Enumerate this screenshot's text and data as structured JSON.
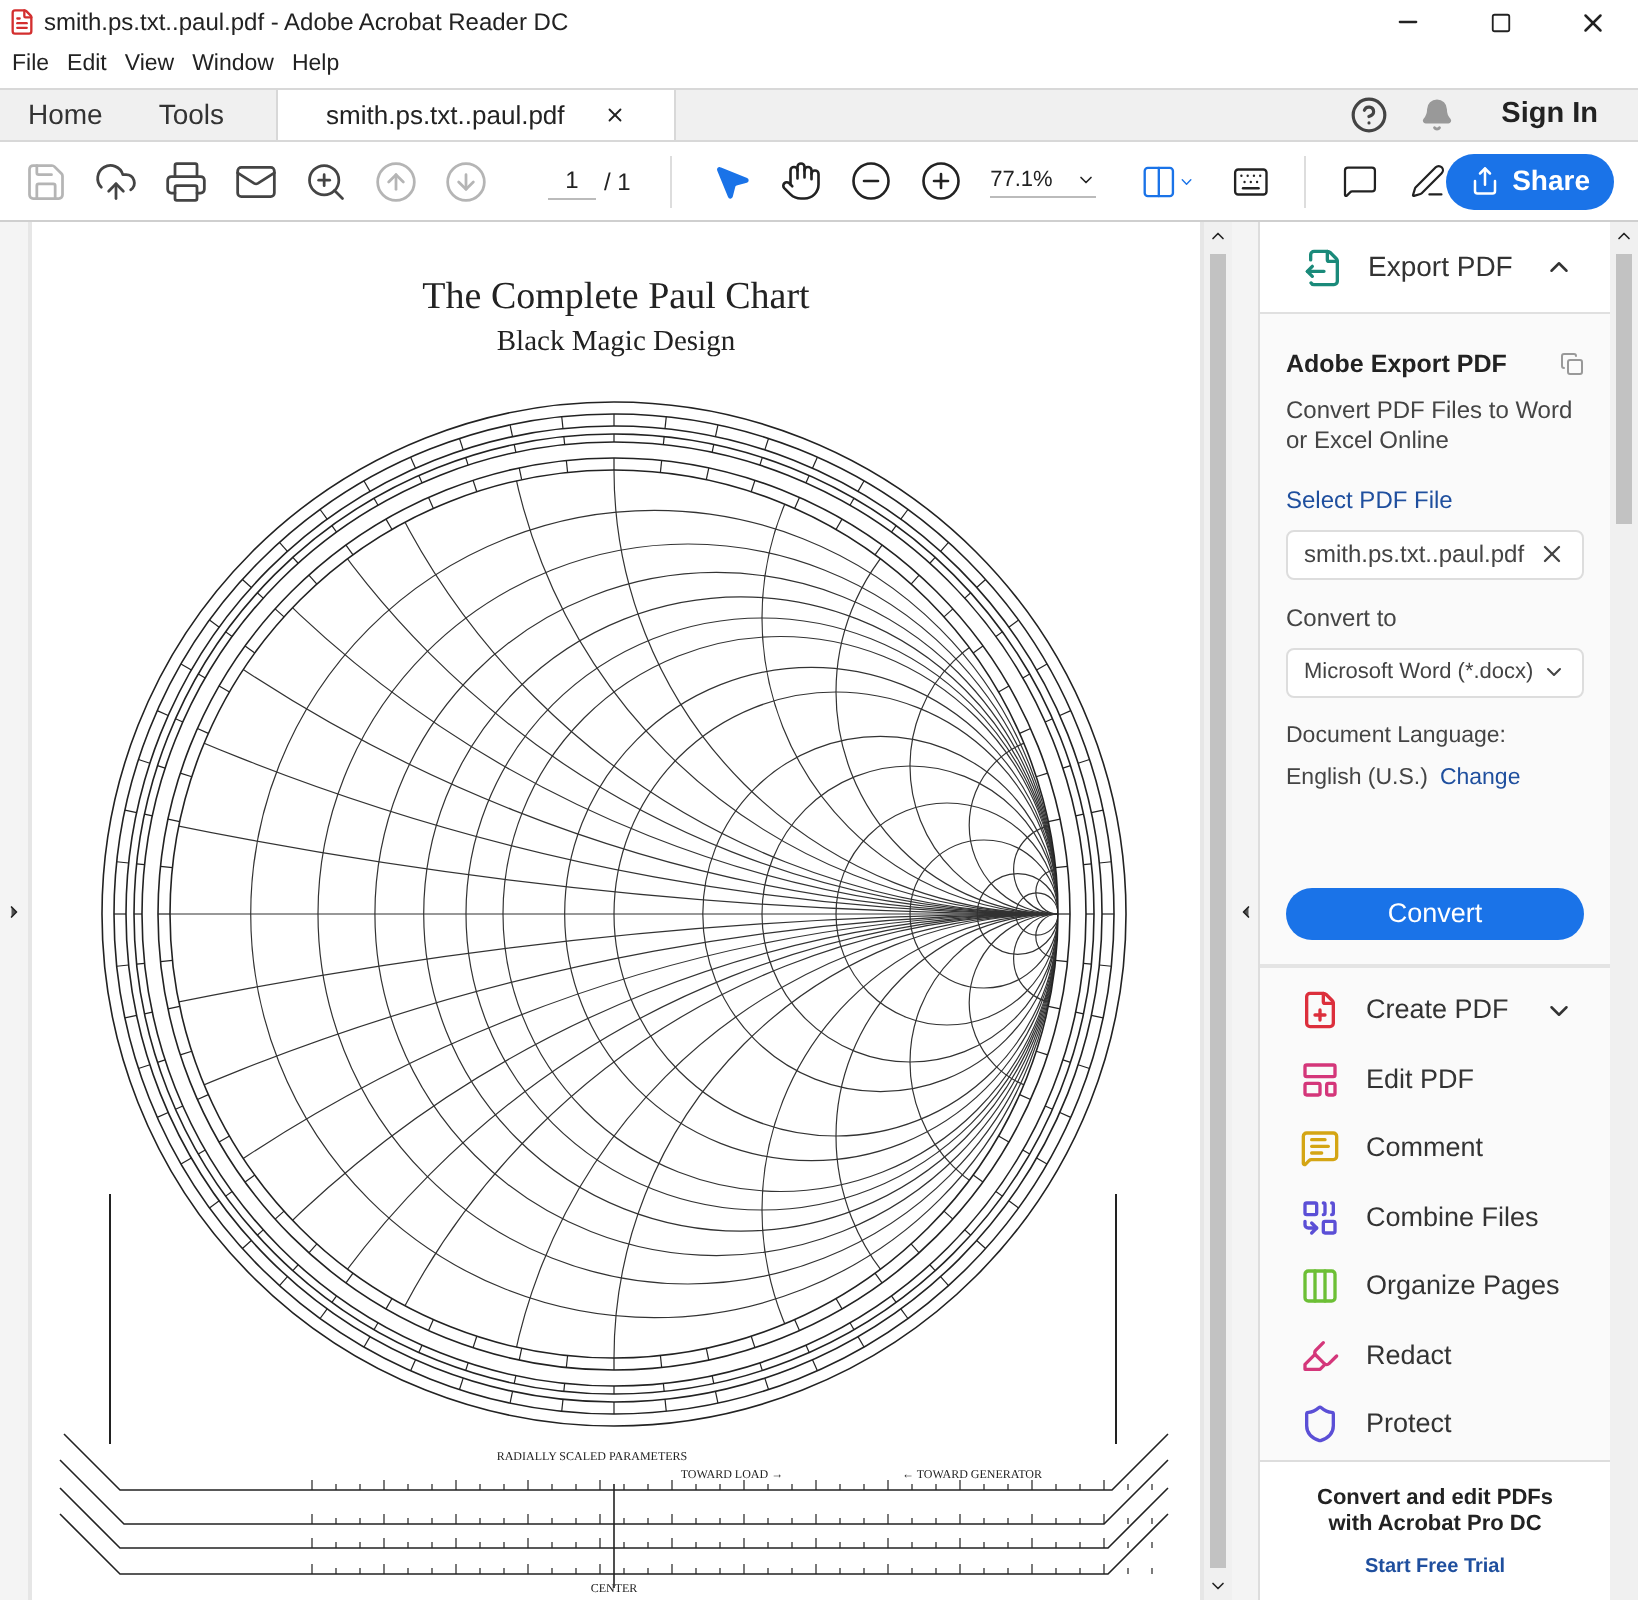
{
  "window": {
    "title": "smith.ps.txt..paul.pdf - Adobe Acrobat Reader DC"
  },
  "menu": [
    "File",
    "Edit",
    "View",
    "Window",
    "Help"
  ],
  "tabs": [
    {
      "label": "Home",
      "selected": false
    },
    {
      "label": "Tools",
      "selected": false
    },
    {
      "label": "smith.ps.txt..paul.pdf",
      "selected": true
    }
  ],
  "sign_in": "Sign In",
  "toolbar": {
    "left": [
      {
        "kind": "save",
        "disabled": true
      },
      {
        "kind": "upload",
        "disabled": false
      },
      {
        "kind": "print",
        "disabled": false
      },
      {
        "kind": "mail",
        "disabled": false
      },
      {
        "kind": "find",
        "disabled": false
      },
      {
        "kind": "prev",
        "disabled": true
      },
      {
        "kind": "next",
        "disabled": true
      }
    ],
    "page_current": "1",
    "page_total": "/ 1",
    "zoom": "77.1%",
    "share": "Share"
  },
  "document": {
    "title": "The Complete Paul Chart",
    "subtitle": "Black Magic Design",
    "scale_labels": [
      {
        "kind": "heading",
        "text": "RADIALLY SCALED PARAMETERS"
      },
      {
        "kind": "load",
        "text": "TOWARD LOAD →"
      },
      {
        "kind": "generator",
        "text": "← TOWARD GENERATOR"
      },
      {
        "kind": "center",
        "text": "CENTER"
      }
    ]
  },
  "panel": {
    "export": {
      "header": "Export PDF",
      "expanded": true,
      "heading": "Adobe Export PDF",
      "description": "Convert PDF Files to Word or Excel Online",
      "select_label": "Select PDF File",
      "file": "smith.ps.txt..paul.pdf",
      "convert_to_label": "Convert to",
      "convert_to": "Microsoft Word (*.docx)",
      "language_label": "Document Language:",
      "language": "English (U.S.)",
      "change": "Change",
      "button": "Convert"
    },
    "tools": [
      {
        "kind": "create",
        "label": "Create PDF",
        "expandable": true
      },
      {
        "kind": "edit",
        "label": "Edit PDF",
        "expandable": false
      },
      {
        "kind": "comment",
        "label": "Comment",
        "expandable": false
      },
      {
        "kind": "combine",
        "label": "Combine Files",
        "expandable": false
      },
      {
        "kind": "organize",
        "label": "Organize Pages",
        "expandable": false
      },
      {
        "kind": "redact",
        "label": "Redact",
        "expandable": false
      },
      {
        "kind": "protect",
        "label": "Protect",
        "expandable": false
      }
    ],
    "promo": {
      "text": "Convert and edit PDFs with Acrobat Pro DC",
      "link": "Start Free Trial"
    }
  }
}
